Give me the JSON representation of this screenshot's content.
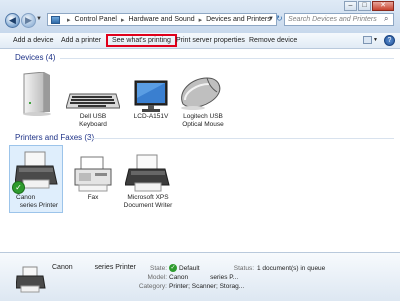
{
  "address": {
    "crumbs": [
      "Control Panel",
      "Hardware and Sound",
      "Devices and Printers"
    ],
    "search_placeholder": "Search Devices and Printers"
  },
  "toolbar": {
    "add_device": "Add a device",
    "add_printer": "Add a printer",
    "see_printing": "See what's printing",
    "print_server": "Print server properties",
    "remove_device": "Remove device"
  },
  "devices": {
    "header": "Devices (4)",
    "items": [
      {
        "line1": "",
        "line2": "",
        "icon": "external-drive-icon"
      },
      {
        "line1": "Dell USB",
        "line2": "Keyboard",
        "icon": "keyboard-icon"
      },
      {
        "line1": "LCD-A151V",
        "line2": "",
        "icon": "monitor-icon"
      },
      {
        "line1": "Logitech USB",
        "line2": "Optical Mouse",
        "icon": "mouse-icon"
      }
    ]
  },
  "printers": {
    "header": "Printers and Faxes (3)",
    "items": [
      {
        "line1": "Canon",
        "line2": "series Printer",
        "icon": "printer-icon",
        "default": true
      },
      {
        "line1": "Fax",
        "line2": "",
        "icon": "fax-icon"
      },
      {
        "line1": "Microsoft XPS",
        "line2": "Document Writer",
        "icon": "printer-icon"
      }
    ]
  },
  "details": {
    "name_a": "Canon",
    "name_b": "series Printer",
    "state_label": "State:",
    "state_value": "Default",
    "status_label": "Status:",
    "status_value": "1 document(s) in queue",
    "model_label": "Model:",
    "model_value_a": "Canon",
    "model_value_b": "series P...",
    "category_label": "Category:",
    "category_value": "Printer; Scanner; Storag..."
  },
  "colors": {
    "highlight_box": "#e0001b",
    "group_header": "#1e3287",
    "default_check": "#2e9b2e"
  }
}
